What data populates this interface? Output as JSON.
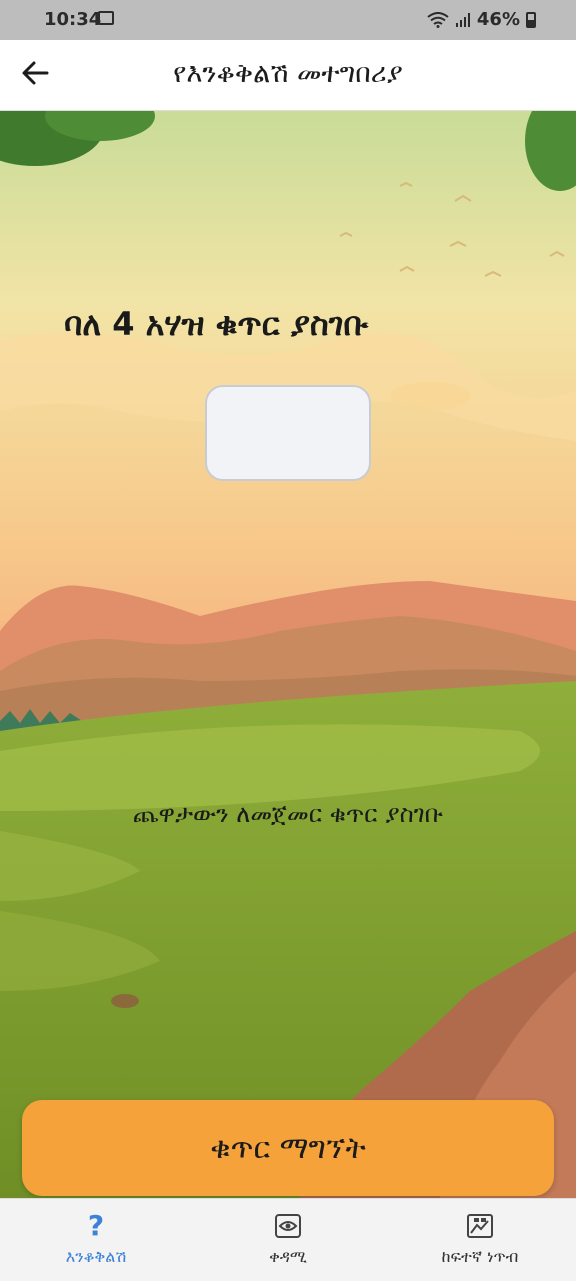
{
  "status": {
    "time": "10:34",
    "battery": "46%"
  },
  "header": {
    "title": "የእንቆቅልሽ መተግበሪያ"
  },
  "main": {
    "heading": "ባለ 4 አሃዝ ቁጥር ያስገቡ",
    "code_value": "",
    "hint": "ጨዋታውን ለመጀመር ቁጥር ያስገቡ",
    "button_label": "ቁጥር ማግኘት"
  },
  "nav": [
    {
      "label": "እንቆቅልሽ",
      "icon": "question-icon"
    },
    {
      "label": "ቀዳሚ",
      "icon": "eye-icon"
    },
    {
      "label": "ከፍተኛ ነጥብ",
      "icon": "scoreboard-icon"
    }
  ],
  "colors": {
    "accent": "#3b82d8",
    "button": "#f6a23b"
  }
}
